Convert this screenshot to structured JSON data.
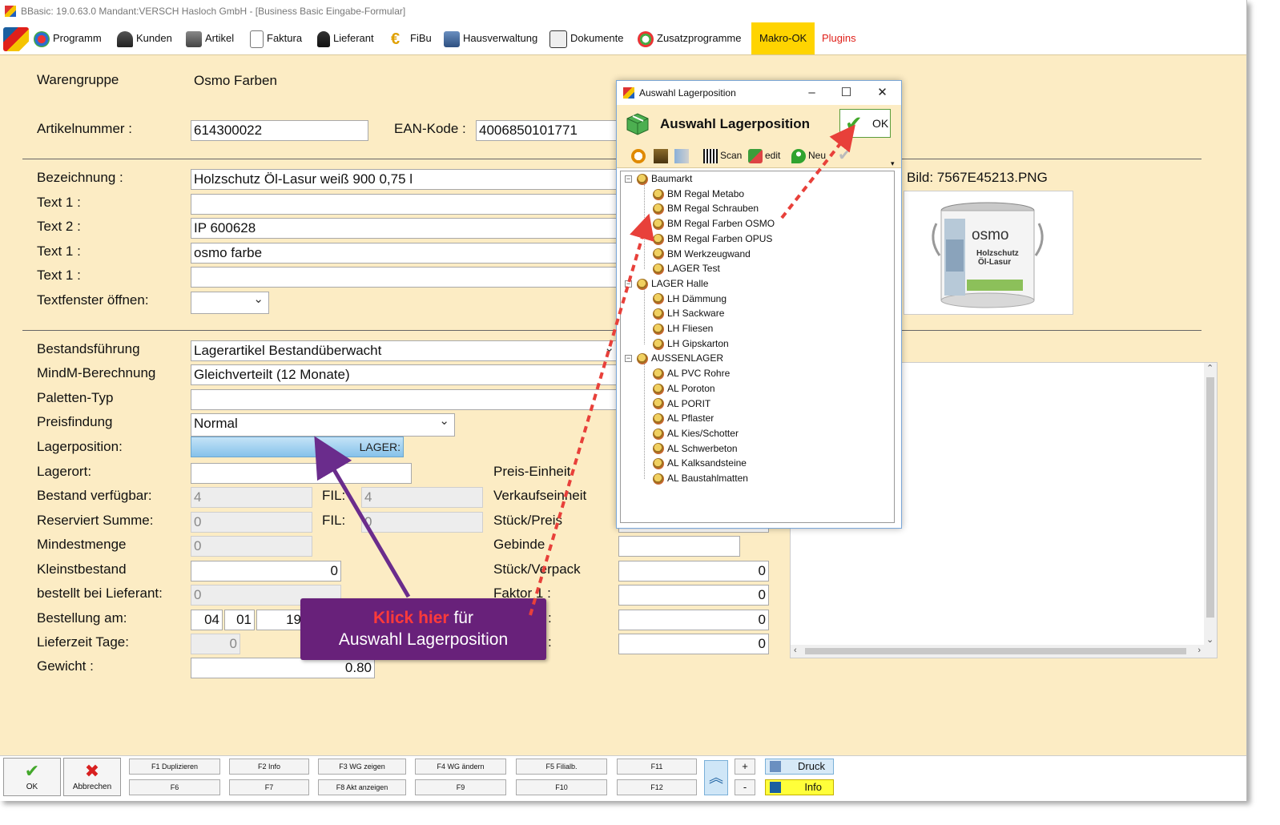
{
  "window": {
    "title": "BBasic: 19.0.63.0 Mandant:VERSCH Hasloch GmbH  - [Business Basic Eingabe-Formular]"
  },
  "menu": {
    "items": [
      "Programm",
      "Kunden",
      "Artikel",
      "Faktura",
      "Lieferant",
      "FiBu",
      "Hausverwaltung",
      "Dokumente",
      "Zusatzprogramme"
    ],
    "makro": "Makro-OK",
    "plugins": "Plugins"
  },
  "form": {
    "warengruppe_label": "Warengruppe",
    "warengruppe_value": "Osmo Farben",
    "artikelnummer_label": "Artikelnummer :",
    "artikelnummer_value": "614300022",
    "ean_label": "EAN-Kode :",
    "ean_value": "4006850101771",
    "bezeichnung_label": "Bezeichnung :",
    "bezeichnung_value": "Holzschutz Öl-Lasur weiß 900 0,75 l",
    "text1a_label": "Text 1 :",
    "text1a_value": "",
    "text2_label": "Text 2 :",
    "text2_value": "IP 600628",
    "text1b_label": "Text 1 :",
    "text1b_value": "osmo farbe",
    "text1c_label": "Text 1 :",
    "text1c_value": "",
    "textfenster_label": "Textfenster öffnen:",
    "textfenster_value": "",
    "bild_label": "Bild: 7567E45213.PNG",
    "product_brand": "osmo",
    "product_line1": "Holzschutz",
    "product_line2": "Öl-Lasur"
  },
  "stock": {
    "bestand_label": "Bestandsführung",
    "bestand_value": "Lagerartikel Bestandüberwacht",
    "mindm_label": "MindM-Berechnung",
    "mindm_value": "Gleichverteilt (12 Monate)",
    "paletten_label": "Paletten-Typ",
    "paletten_value": "",
    "preisfindung_label": "Preisfindung",
    "preisfindung_value": "Normal",
    "lagerposition_label": "Lagerposition:",
    "lagerposition_value": "LAGER:",
    "lagerort_label": "Lagerort:",
    "lagerort_value": "",
    "verfuegbar_label": "Bestand verfügbar:",
    "verfuegbar_value": "4",
    "fil1_label": "FIL:",
    "fil1_value": "4",
    "reserviert_label": "Reserviert Summe:",
    "reserviert_value": "0",
    "fil2_label": "FIL:",
    "fil2_value": "0",
    "mindestmenge_label": "Mindestmenge",
    "mindestmenge_value": "0",
    "kleinst_label": "Kleinstbestand",
    "kleinst_value": "0",
    "bestellt_label": "bestellt bei Lieferant:",
    "bestellt_value": "0",
    "bestellung_label": "Bestellung am:",
    "bestellung_day": "04",
    "bestellung_month": "01",
    "bestellung_year": "19",
    "lieferzeit_label": "Lieferzeit Tage:",
    "lieferzeit_value": "0",
    "gewicht_label": "Gewicht :",
    "gewicht_value": "0.80",
    "preiseinheit_label": "Preis-Einheit",
    "verkaufseinheit_label": "Verkaufseinheit",
    "stueckpreis_label": "Stück/Preis",
    "gebinde_label": "Gebinde",
    "gebinde_value": "",
    "stueckverpack_label": "Stück/Verpack",
    "stueckverpack_value": "0",
    "faktor1_label": "Faktor 1 :",
    "faktor1_value": "0",
    "faktor2_label": ":",
    "faktor2_value": "0",
    "faktor3_label": ":",
    "faktor3_value": "0"
  },
  "dialog": {
    "title": "Auswahl Lagerposition",
    "heading": "Auswahl Lagerposition",
    "ok": "OK",
    "toolbar": {
      "scan": "Scan",
      "edit": "edit",
      "neu": "Neu"
    },
    "tree": [
      {
        "label": "Baumarkt",
        "level": 0
      },
      {
        "label": "BM Regal Metabo",
        "level": 1
      },
      {
        "label": "BM Regal Schrauben",
        "level": 1
      },
      {
        "label": "BM Regal Farben OSMO",
        "level": 1
      },
      {
        "label": "BM Regal Farben OPUS",
        "level": 1
      },
      {
        "label": "BM Werkzeugwand",
        "level": 1
      },
      {
        "label": "LAGER Test",
        "level": 1
      },
      {
        "label": "LAGER Halle",
        "level": 0
      },
      {
        "label": "LH Dämmung",
        "level": 1
      },
      {
        "label": "LH Sackware",
        "level": 1
      },
      {
        "label": "LH Fliesen",
        "level": 1
      },
      {
        "label": "LH Gipskarton",
        "level": 1
      },
      {
        "label": "AUSSENLAGER",
        "level": 0
      },
      {
        "label": "AL PVC Rohre",
        "level": 1
      },
      {
        "label": "AL Poroton",
        "level": 1
      },
      {
        "label": "AL PORIT",
        "level": 1
      },
      {
        "label": "AL Pflaster",
        "level": 1
      },
      {
        "label": "AL Kies/Schotter",
        "level": 1
      },
      {
        "label": "AL Schwerbeton",
        "level": 1
      },
      {
        "label": "AL Kalksandsteine",
        "level": 1
      },
      {
        "label": "AL Baustahlmatten",
        "level": 1
      }
    ]
  },
  "callout": {
    "highlight": "Klick hier",
    "rest1": "für",
    "line2": "Auswahl Lagerposition"
  },
  "bottom": {
    "ok": "OK",
    "abbrechen": "Abbrechen",
    "fkeys_top": [
      "F1 Duplizieren",
      "F2 Info",
      "F3 WG zeigen",
      "F4 WG ändern",
      "F5 Filialb.",
      "F11"
    ],
    "fkeys_bottom": [
      "F6",
      "F7",
      "F8 Akt anzeigen",
      "F9",
      "F10",
      "F12"
    ],
    "plus": "+",
    "minus": "-",
    "druck": "Druck",
    "info": "Info"
  },
  "colors": {
    "background": "#fcecc4",
    "makro": "#ffd400",
    "plugins": "#e0201a",
    "callout": "#68217a",
    "arrow": "#6a2c8c",
    "dash": "#e8403a"
  }
}
